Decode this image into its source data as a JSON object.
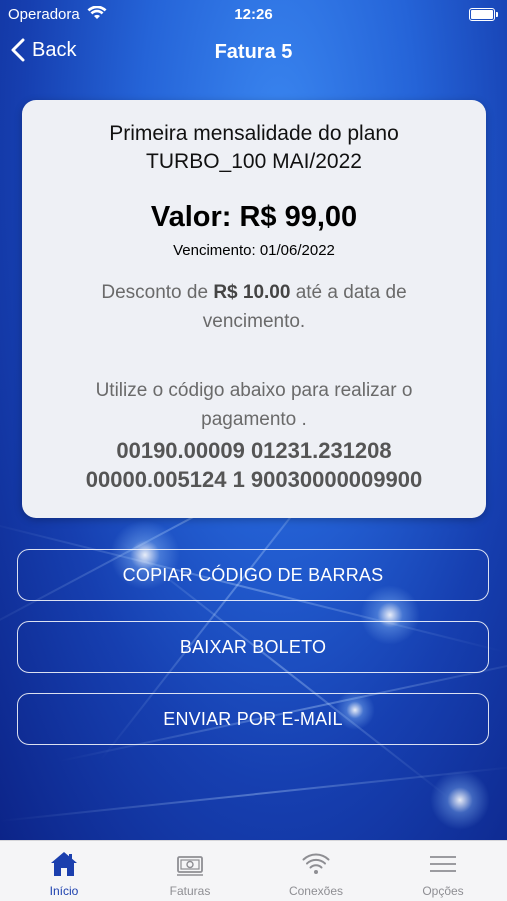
{
  "status_bar": {
    "carrier": "Operadora",
    "time": "12:26"
  },
  "nav": {
    "back_label": "Back",
    "title": "Fatura 5"
  },
  "invoice": {
    "plan_line1": "Primeira mensalidade do plano",
    "plan_line2": "TURBO_100 MAI/2022",
    "valor": "Valor: R$ 99,00",
    "vencimento": "Vencimento: 01/06/2022",
    "desconto_prefix": "Desconto de ",
    "desconto_amount": "R$ 10.00",
    "desconto_suffix": " até a data de vencimento.",
    "instructions": "Utilize o código abaixo para realizar o pagamento .",
    "barcode_line1": "00190.00009 01231.231208",
    "barcode_line2": "00000.005124 1 90030000009900"
  },
  "actions": {
    "copy_barcode": "COPIAR CÓDIGO DE BARRAS",
    "download_boleto": "BAIXAR BOLETO",
    "send_email": "ENVIAR POR E-MAIL"
  },
  "tabs": [
    {
      "label": "Início",
      "icon": "home-icon",
      "active": true
    },
    {
      "label": "Faturas",
      "icon": "bill-icon",
      "active": false
    },
    {
      "label": "Conexões",
      "icon": "wifi-icon",
      "active": false
    },
    {
      "label": "Opções",
      "icon": "menu-icon",
      "active": false
    }
  ],
  "colors": {
    "accent": "#1b3fae",
    "card_bg": "#eef0f5",
    "tab_inactive": "#8e8e93"
  }
}
